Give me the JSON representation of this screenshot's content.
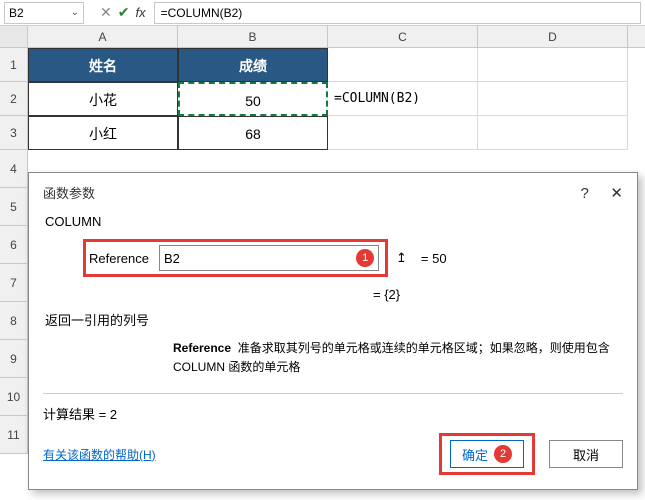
{
  "name_box": {
    "value": "B2"
  },
  "formula_bar": {
    "formula": "=COLUMN(B2)"
  },
  "columns": {
    "A": "A",
    "B": "B",
    "C": "C",
    "D": "D"
  },
  "row_labels": [
    "1",
    "2",
    "3",
    "4",
    "5",
    "6",
    "7",
    "8",
    "9",
    "10",
    "11"
  ],
  "table": {
    "header": {
      "name": "姓名",
      "score": "成绩"
    },
    "rows": [
      {
        "name": "小花",
        "score": "50"
      },
      {
        "name": "小红",
        "score": "68"
      }
    ]
  },
  "inline_cell": {
    "text": "=COLUMN(B2)"
  },
  "dialog": {
    "title": "函数参数",
    "help_icon": "?",
    "close_icon": "✕",
    "func_name": "COLUMN",
    "arg_label": "Reference",
    "arg_value": "B2",
    "arg_eval": "= 50",
    "array_eval": "= {2}",
    "desc_main": "返回一引用的列号",
    "desc_param_label": "Reference",
    "desc_param_text": "准备求取其列号的单元格或连续的单元格区域；如果忽略，则使用包含 COLUMN 函数的单元格",
    "result_label": "计算结果 = 2",
    "help_link": "有关该函数的帮助(H)",
    "ok": "确定",
    "cancel": "取消",
    "badge1": "1",
    "badge2": "2"
  }
}
